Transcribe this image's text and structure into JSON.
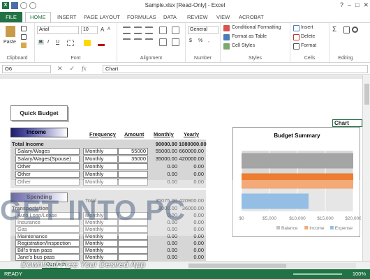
{
  "window": {
    "title": "Sample.xlsx  [Read-Only] - Excel",
    "min": "–",
    "max": "□",
    "close": "✕",
    "help": "?"
  },
  "tabs": [
    "FILE",
    "HOME",
    "INSERT",
    "PAGE LAYOUT",
    "FORMULAS",
    "DATA",
    "REVIEW",
    "VIEW",
    "ACROBAT"
  ],
  "ribbon": {
    "clipboard": {
      "paste": "Paste",
      "label": "Clipboard"
    },
    "font": {
      "name": "Arial",
      "size": "10",
      "bold": "B",
      "italic": "I",
      "underline": "U",
      "grow": "A",
      "shrink": "A",
      "label": "Font"
    },
    "alignment": {
      "label": "Alignment"
    },
    "number": {
      "format": "General",
      "currency": "$",
      "percent": "%",
      "comma": ",",
      "label": "Number"
    },
    "styles": {
      "conditional": "Conditional Formatting",
      "table": "Format as Table",
      "cell": "Cell Styles",
      "label": "Styles"
    },
    "cells": {
      "insert": "Insert",
      "delete": "Delete",
      "format": "Format",
      "label": "Cells"
    },
    "editing": {
      "sum": "Σ",
      "sort": "Sort",
      "find": "Find",
      "label": "Editing"
    }
  },
  "formula_bar": {
    "name_box": "O6",
    "cancel": "✕",
    "enter": "✓",
    "fx": "fx",
    "content": "Chart"
  },
  "sheet": {
    "quick_budget": "Quick Budget",
    "income_header": "Income",
    "spending_header": "Spending",
    "columns": {
      "frequency": "Frequency",
      "amount": "Amount",
      "monthly": "Monthly",
      "yearly": "Yearly"
    },
    "total_income": {
      "label": "Total Income",
      "monthly": "90000.00",
      "yearly": "1080000.00"
    },
    "income_rows": [
      {
        "label": "Salary/Wages",
        "freq": "Monthly",
        "amount": "55000",
        "monthly": "55000.00",
        "yearly": "660000.00"
      },
      {
        "label": "Salary/Wages(Spouse)",
        "freq": "Monthly",
        "amount": "35000",
        "monthly": "35000.00",
        "yearly": "420000.00"
      },
      {
        "label": "Other",
        "freq": "Monthly",
        "amount": "",
        "monthly": "0.00",
        "yearly": "0.00"
      },
      {
        "label": "Other",
        "freq": "Monthly",
        "amount": "",
        "monthly": "0.00",
        "yearly": "0.00"
      },
      {
        "label": "Other",
        "freq": "Monthly",
        "amount": "",
        "monthly": "0.00",
        "yearly": "0.00"
      }
    ],
    "total_spending": {
      "label": "Total",
      "monthly": "35075.00",
      "yearly": "420900.00"
    },
    "transportation": {
      "label": "Transportation",
      "monthly": "3000.00",
      "yearly": "36000.00"
    },
    "spending_rows": [
      {
        "label": "Auto Loan/Lease",
        "freq": "Monthly",
        "monthly": "0.00",
        "yearly": "0.00"
      },
      {
        "label": "Insurance",
        "freq": "Monthly",
        "monthly": "0.00",
        "yearly": "0.00"
      },
      {
        "label": "Gas",
        "freq": "Monthly",
        "monthly": "0.00",
        "yearly": "0.00"
      },
      {
        "label": "Maintenance",
        "freq": "Monthly",
        "monthly": "0.00",
        "yearly": "0.00"
      },
      {
        "label": "Registration/Inspection",
        "freq": "Monthly",
        "monthly": "0.00",
        "yearly": "0.00"
      },
      {
        "label": "Bill's train pass",
        "freq": "Monthly",
        "monthly": "0.00",
        "yearly": "0.00"
      },
      {
        "label": "Jane's bus pass",
        "freq": "Monthly",
        "monthly": "0.00",
        "yearly": "0.00"
      }
    ],
    "chart_name_label": "Chart"
  },
  "chart_data": {
    "type": "bar",
    "orientation": "horizontal",
    "title": "Budget Summary",
    "categories": [
      "Balance",
      "Income",
      "Expense"
    ],
    "values": [
      55000,
      90000,
      12000
    ],
    "colors": [
      "#a5a5a5",
      "#ed7d31",
      "#5b9bd5"
    ],
    "xlim": [
      0,
      20000
    ],
    "ticks": [
      "$0",
      "$5,000",
      "$10,000",
      "$15,000",
      "$20,000"
    ],
    "grid": true,
    "legend": "bottom"
  },
  "sheet_tab": "Overview",
  "status": {
    "left": "READY",
    "zoom": "100%"
  },
  "watermark": {
    "big": "GET INTO PC",
    "small": "Download Free Your Desired App"
  }
}
